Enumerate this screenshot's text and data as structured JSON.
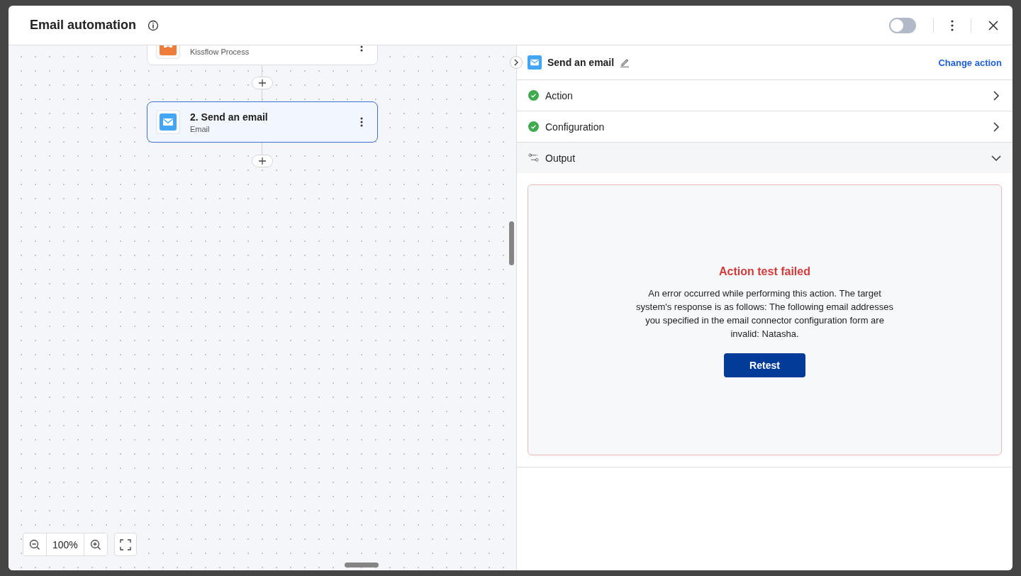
{
  "window": {
    "title": "Email automation",
    "enabled": false
  },
  "flow": {
    "steps": [
      {
        "kind": "process",
        "subtitle": "Kissflow Process",
        "selected": false
      },
      {
        "kind": "email",
        "title": "2. Send an email",
        "subtitle": "Email",
        "selected": true
      }
    ]
  },
  "zoom": {
    "value": "100%"
  },
  "panel": {
    "title": "Send an email",
    "change_action": "Change action",
    "sections": [
      {
        "kind": "done",
        "label": "Action",
        "expanded": false
      },
      {
        "kind": "done",
        "label": "Configuration",
        "expanded": false
      },
      {
        "kind": "output",
        "label": "Output",
        "expanded": true
      }
    ],
    "error": {
      "title": "Action test failed",
      "message": "An error occurred while performing this action. The target system's response is as follows: The following email addresses you specified in the email connector configuration form are invalid: Natasha.",
      "button": "Retest"
    }
  }
}
